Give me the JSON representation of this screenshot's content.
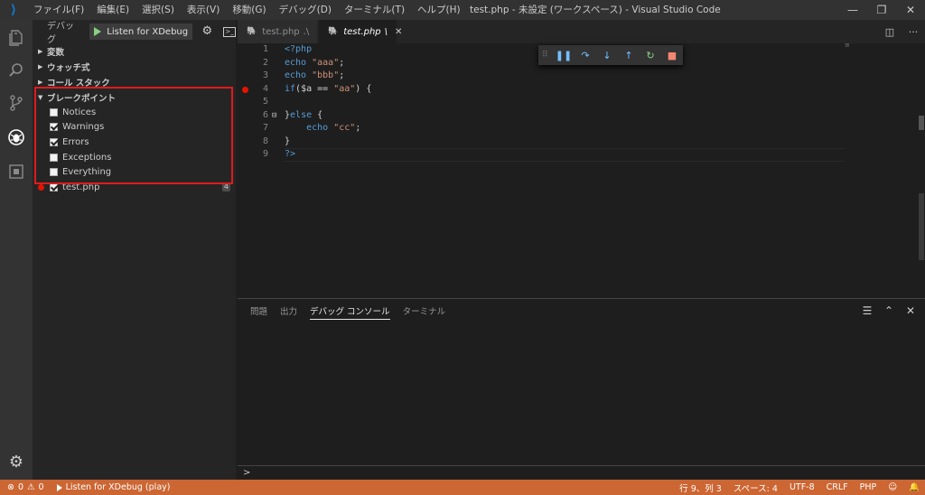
{
  "titlebar": {
    "menu": [
      "ファイル(F)",
      "編集(E)",
      "選択(S)",
      "表示(V)",
      "移動(G)",
      "デバッグ(D)",
      "ターミナル(T)",
      "ヘルプ(H)"
    ],
    "title": "test.php - 未設定 (ワークスペース) - Visual Studio Code",
    "controls": {
      "minimize": "—",
      "restore": "❐",
      "close": "✕"
    }
  },
  "activitybar": {
    "icons": [
      "explorer-icon",
      "search-icon",
      "source-control-icon",
      "debug-icon",
      "extensions-icon"
    ],
    "settings": "gear-icon"
  },
  "sidebar": {
    "debug_label": "デバッグ",
    "launch_config": "Listen for XDebug (",
    "sections": {
      "variables": "変数",
      "watch": "ウォッチ式",
      "callstack": "コール スタック",
      "breakpoints": "ブレークポイント"
    },
    "breakpoints": [
      {
        "label": "Notices",
        "checked": false
      },
      {
        "label": "Warnings",
        "checked": true
      },
      {
        "label": "Errors",
        "checked": true
      },
      {
        "label": "Exceptions",
        "checked": false
      },
      {
        "label": "Everything",
        "checked": false
      }
    ],
    "file_breakpoint": {
      "label": "test.php",
      "line": "4"
    }
  },
  "tabs": {
    "inactive": {
      "label": "test.php",
      "path": ".\\"
    },
    "active": {
      "label": "test.php",
      "path": "\\"
    },
    "close": "✕"
  },
  "editor": {
    "lines": [
      {
        "n": "1",
        "text": "<?php"
      },
      {
        "n": "2",
        "text": "echo \"aaa\";"
      },
      {
        "n": "3",
        "text": "echo \"bbb\";"
      },
      {
        "n": "4",
        "text": "if($a == \"aa\") {"
      },
      {
        "n": "5",
        "text": ""
      },
      {
        "n": "6",
        "text": "}else {"
      },
      {
        "n": "7",
        "text": "    echo \"cc\";"
      },
      {
        "n": "8",
        "text": "}"
      },
      {
        "n": "9",
        "text": "?>"
      }
    ]
  },
  "panel": {
    "tabs": [
      "問題",
      "出力",
      "デバッグ コンソール",
      "ターミナル"
    ],
    "active_tab": "デバッグ コンソール",
    "prompt": ">"
  },
  "statusbar": {
    "errors": "0",
    "warnings": "0",
    "debug_config": "Listen for XDebug (play)",
    "position": "行 9、列 3",
    "spaces": "スペース: 4",
    "encoding": "UTF-8",
    "eol": "CRLF",
    "language": "PHP",
    "color": "#cc6633"
  }
}
